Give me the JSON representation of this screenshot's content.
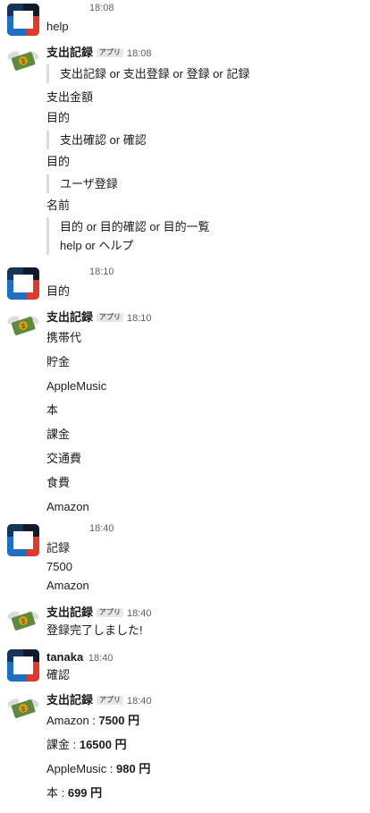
{
  "messages": {
    "m1": {
      "time": "18:08",
      "lines": [
        "help"
      ]
    },
    "m2": {
      "sender": "支出記録",
      "badge": "アプリ",
      "time": "18:08",
      "q1": [
        "支出記録 or 支出登録 or 登録 or 記録"
      ],
      "l1": [
        "支出金額",
        "目的"
      ],
      "q2": [
        "支出確認 or 確認"
      ],
      "l2": [
        "目的"
      ],
      "q3": [
        "ユーザ登録"
      ],
      "l3": [
        "名前"
      ],
      "q4": [
        "目的 or 目的確認 or 目的一覧",
        "help or ヘルプ"
      ]
    },
    "m3": {
      "time": "18:10",
      "lines": [
        "目的"
      ]
    },
    "m4": {
      "sender": "支出記録",
      "badge": "アプリ",
      "time": "18:10",
      "items": [
        "携帯代",
        "貯金",
        "AppleMusic",
        "本",
        "課金",
        "交通費",
        "食費",
        "Amazon"
      ]
    },
    "m5": {
      "time": "18:40",
      "lines": [
        "記録",
        "7500",
        "Amazon"
      ]
    },
    "m6": {
      "sender": "支出記録",
      "badge": "アプリ",
      "time": "18:40",
      "lines": [
        "登録完了しました!"
      ]
    },
    "m7": {
      "sender": "tanaka",
      "time": "18:40",
      "lines": [
        "確認"
      ]
    },
    "m8": {
      "sender": "支出記録",
      "badge": "アプリ",
      "time": "18:40",
      "rows": [
        {
          "label": "Amazon : ",
          "amount": "7500 円"
        },
        {
          "label": "課金 : ",
          "amount": "16500 円"
        },
        {
          "label": "AppleMusic : ",
          "amount": "980 円"
        },
        {
          "label": "本 : ",
          "amount": "699 円"
        }
      ]
    }
  }
}
